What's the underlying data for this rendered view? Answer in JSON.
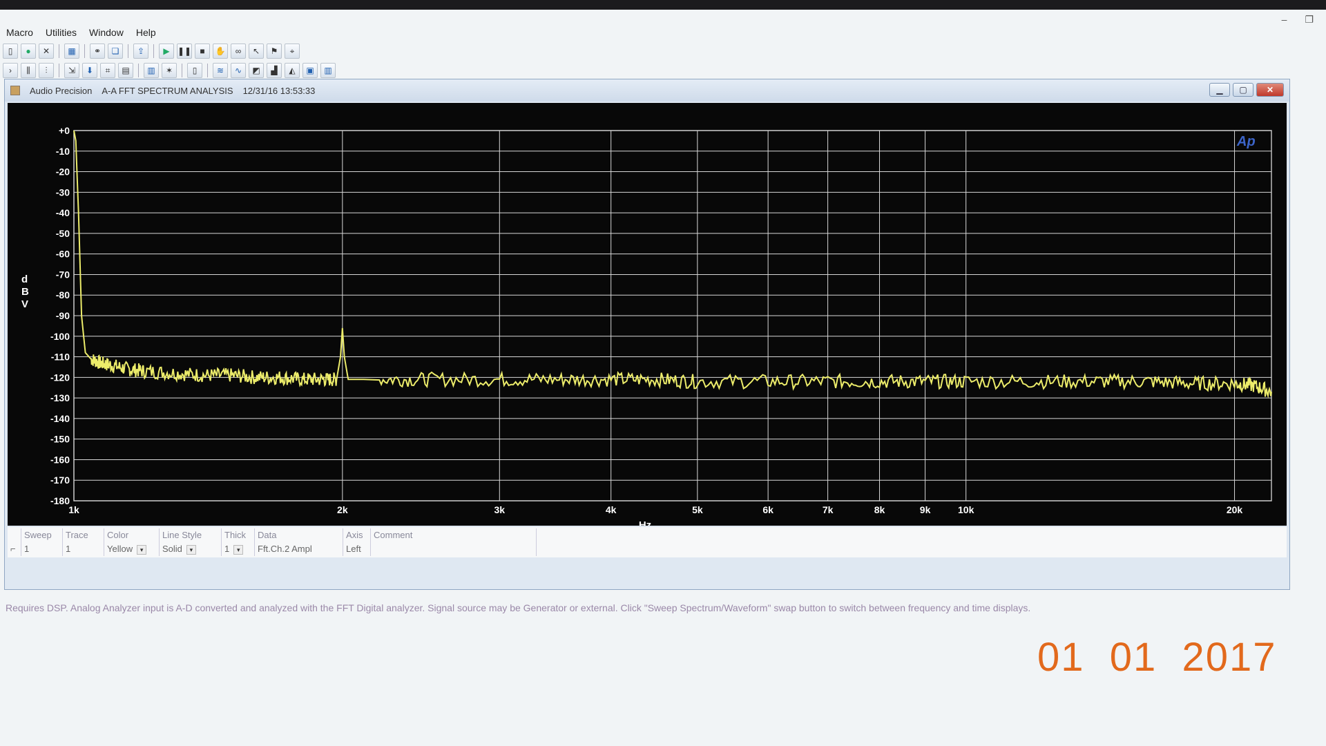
{
  "menu": [
    "Macro",
    "Utilities",
    "Window",
    "Help"
  ],
  "window": {
    "app_name": "Audio Precision",
    "title": "A-A FFT SPECTRUM ANALYSIS",
    "timestamp": "12/31/16 13:53:33",
    "logo": "Ap"
  },
  "chart_data": {
    "type": "line",
    "xlabel": "Hz",
    "ylabel": "dBV",
    "x_scale": "log",
    "xlim": [
      1000,
      22000
    ],
    "ylim": [
      -180,
      0
    ],
    "x_ticks": [
      {
        "v": 1000,
        "label": "1k"
      },
      {
        "v": 2000,
        "label": "2k"
      },
      {
        "v": 3000,
        "label": "3k"
      },
      {
        "v": 4000,
        "label": "4k"
      },
      {
        "v": 5000,
        "label": "5k"
      },
      {
        "v": 6000,
        "label": "6k"
      },
      {
        "v": 7000,
        "label": "7k"
      },
      {
        "v": 8000,
        "label": "8k"
      },
      {
        "v": 9000,
        "label": "9k"
      },
      {
        "v": 10000,
        "label": "10k"
      },
      {
        "v": 20000,
        "label": "20k"
      }
    ],
    "y_ticks": [
      "+0",
      "-10",
      "-20",
      "-30",
      "-40",
      "-50",
      "-60",
      "-70",
      "-80",
      "-90",
      "-100",
      "-110",
      "-120",
      "-130",
      "-140",
      "-150",
      "-160",
      "-170",
      "-180"
    ],
    "grid": true,
    "trace_color": "#ecec6a",
    "series": [
      {
        "x": [
          1000,
          1005,
          1012,
          1020,
          1030,
          1045,
          1070,
          1100,
          1150,
          1200,
          1300,
          1400,
          1500,
          1600,
          1700,
          1800,
          1900,
          1970,
          1990,
          2000,
          2010,
          2030,
          2200,
          2500,
          3000,
          3500,
          4000,
          4500,
          5000,
          6000,
          7000,
          8000,
          9000,
          10000,
          12000,
          14000,
          16000,
          18000,
          20000,
          21000,
          22000
        ],
        "y": [
          0,
          -5,
          -40,
          -90,
          -108,
          -111,
          -113,
          -114,
          -116,
          -117,
          -118,
          -119,
          -119,
          -120,
          -120,
          -121,
          -121,
          -121,
          -110,
          -96,
          -110,
          -121,
          -121,
          -121,
          -121,
          -121,
          -121,
          -121,
          -122,
          -122,
          -122,
          -122,
          -122,
          -122,
          -122,
          -122,
          -122,
          -123,
          -123,
          -124,
          -127
        ]
      }
    ]
  },
  "legend": {
    "headers": [
      "Sweep",
      "Trace",
      "Color",
      "Line Style",
      "Thick",
      "Data",
      "Axis",
      "Comment"
    ],
    "row": {
      "sweep": "1",
      "trace": "1",
      "color": "Yellow",
      "line_style": "Solid",
      "thick": "1",
      "data": "Fft.Ch.2 Ampl",
      "axis": "Left",
      "comment": ""
    }
  },
  "description": "Requires DSP.  Analog Analyzer input is A-D converted and analyzed with the FFT Digital analyzer.  Signal source may be Generator or external.  Click \"Sweep Spectrum/Waveform\" swap button to switch between frequency and time displays.",
  "date_stamp": "01  01  2017"
}
